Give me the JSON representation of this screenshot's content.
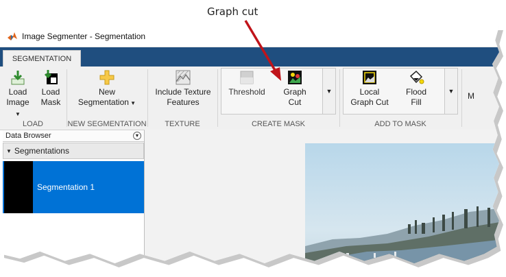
{
  "annotation": {
    "label": "Graph cut"
  },
  "window": {
    "title": "Image Segmenter - Segmentation"
  },
  "tabs": [
    {
      "label": "SEGMENTATION"
    }
  ],
  "ribbon": {
    "load": {
      "group_label": "LOAD",
      "load_image": [
        "Load",
        "Image"
      ],
      "load_mask": [
        "Load",
        "Mask"
      ]
    },
    "new_segmentation": {
      "group_label": "NEW SEGMENTATION",
      "button": [
        "New",
        "Segmentation"
      ]
    },
    "texture": {
      "group_label": "TEXTURE",
      "button": [
        "Include Texture",
        "Features"
      ]
    },
    "create_mask": {
      "group_label": "CREATE MASK",
      "threshold": "Threshold",
      "graph_cut": [
        "Graph",
        "Cut"
      ]
    },
    "add_to_mask": {
      "group_label": "ADD TO MASK",
      "local_graph_cut": [
        "Local",
        "Graph Cut"
      ],
      "flood_fill": [
        "Flood",
        "Fill"
      ]
    },
    "partial_next": "M"
  },
  "data_browser": {
    "title": "Data Browser",
    "segmentations_header": "Segmentations",
    "items": [
      {
        "label": "Segmentation 1"
      }
    ]
  },
  "colors": {
    "tab_strip": "#1f4e7f",
    "selection": "#0072d6",
    "arrow": "#c0141a"
  }
}
